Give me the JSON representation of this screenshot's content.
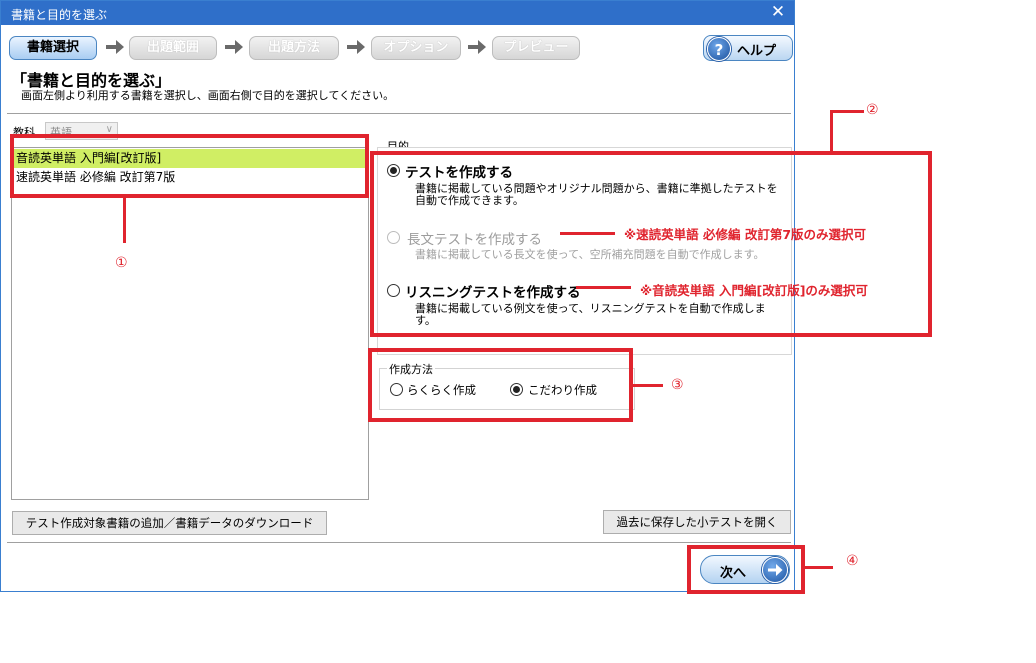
{
  "window": {
    "title": "書籍と目的を選ぶ",
    "close_glyph": "✕"
  },
  "steps": {
    "items": [
      {
        "label": "書籍選択",
        "state": "active"
      },
      {
        "label": "出題範囲",
        "state": "inactive"
      },
      {
        "label": "出題方法",
        "state": "inactive"
      },
      {
        "label": "オプション",
        "state": "inactive"
      },
      {
        "label": "プレビュー",
        "state": "inactive"
      }
    ],
    "help_label": "ヘルプ",
    "help_icon_glyph": "?"
  },
  "header": {
    "title": "「書籍と目的を選ぶ」",
    "subtitle": "画面左側より利用する書籍を選択し、画面右側で目的を選択してください。"
  },
  "subject": {
    "label": "教科",
    "value": "英語",
    "chevron": "∨"
  },
  "books": {
    "items": [
      {
        "label": "音読英単語 入門編[改訂版]",
        "selected": true
      },
      {
        "label": "速読英単語 必修編 改訂第7版",
        "selected": false
      }
    ]
  },
  "purpose": {
    "label": "目的",
    "options": [
      {
        "title": "テストを作成する",
        "desc": "書籍に掲載している問題やオリジナル問題から、書籍に準拠したテストを自動で作成できます。",
        "checked": true,
        "enabled": true
      },
      {
        "title": "長文テストを作成する",
        "desc": "書籍に掲載している長文を使って、空所補充問題を自動で作成します。",
        "checked": false,
        "enabled": false
      },
      {
        "title": "リスニングテストを作成する",
        "desc": "書籍に掲載している例文を使って、リスニングテストを自動で作成します。",
        "checked": false,
        "enabled": true
      }
    ]
  },
  "method": {
    "label": "作成方法",
    "options": [
      {
        "label": "らくらく作成",
        "checked": false
      },
      {
        "label": "こだわり作成",
        "checked": true
      }
    ]
  },
  "buttons": {
    "add_books": "テスト作成対象書籍の追加／書籍データのダウンロード",
    "open_saved": "過去に保存した小テストを開く",
    "next": "次へ"
  },
  "annotations": {
    "nums": [
      "①",
      "②",
      "③",
      "④"
    ],
    "note_long": "※速読英単語 必修編 改訂第7版のみ選択可",
    "note_listening": "※音読英単語 入門編[改訂版]のみ選択可"
  },
  "colors": {
    "titlebar": "#2f6fc9",
    "annotation_red": "#e0242e",
    "selected_row": "#d0ee64"
  }
}
